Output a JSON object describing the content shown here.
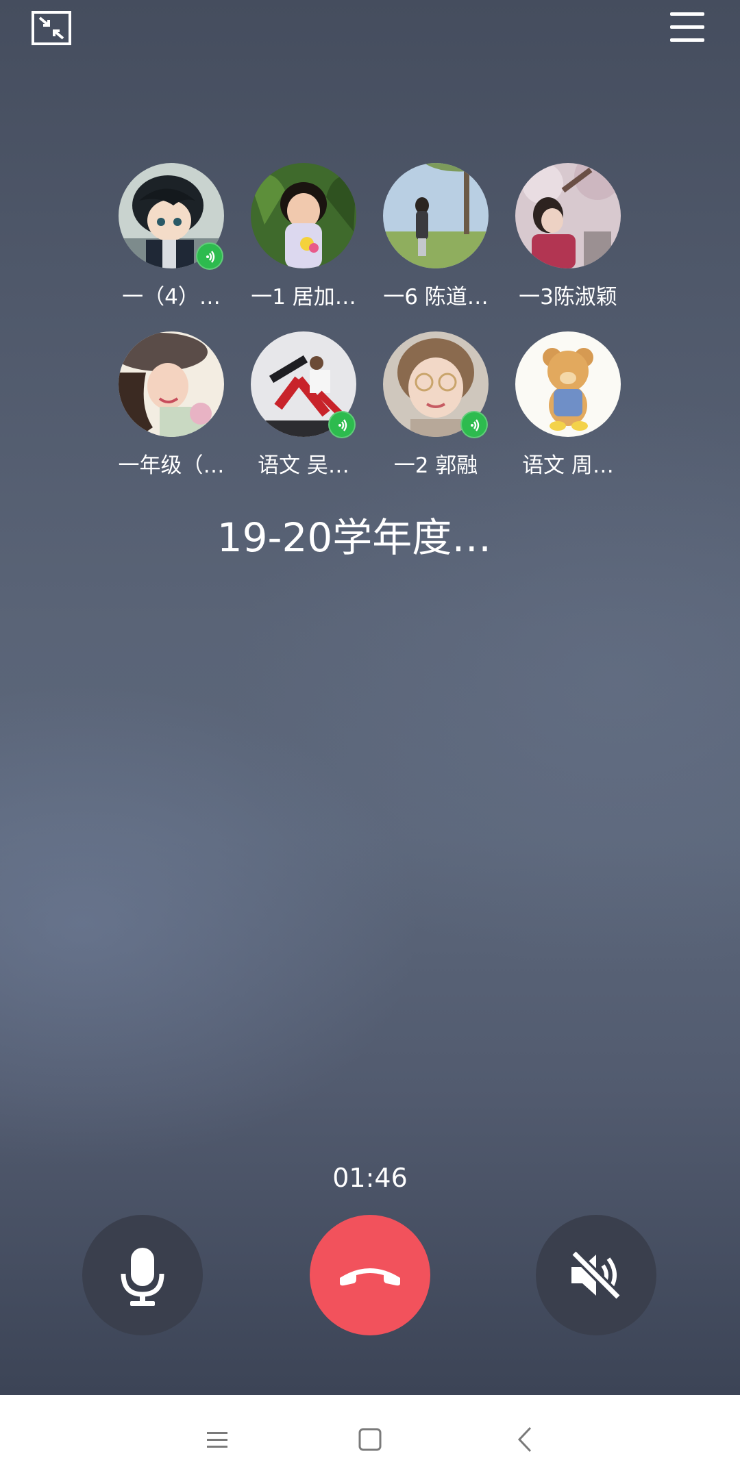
{
  "group_title": "19-20学年度…",
  "call_timer": "01:46",
  "participants": [
    {
      "name": "一（4）…",
      "speaking": true,
      "avatar": "cartoon-boy"
    },
    {
      "name": "一1 居加…",
      "speaking": false,
      "avatar": "girl-with-flowers"
    },
    {
      "name": "一6 陈道…",
      "speaking": false,
      "avatar": "person-under-tree"
    },
    {
      "name": "一3陈淑颖",
      "speaking": false,
      "avatar": "woman-with-blossoms"
    },
    {
      "name": "一年级（…",
      "speaking": false,
      "avatar": "woman-with-hat"
    },
    {
      "name": "语文  吴…",
      "speaking": true,
      "avatar": "dancers"
    },
    {
      "name": "一2 郭融",
      "speaking": true,
      "avatar": "child-with-glasses"
    },
    {
      "name": "语文 周…",
      "speaking": false,
      "avatar": "teddy-bear"
    }
  ],
  "controls": {
    "mic_icon": "microphone-icon",
    "hangup_icon": "hang-up-phone-icon",
    "speaker_icon": "speaker-muted-icon",
    "hangup_color": "#f2525c",
    "speaking_color": "#2dbb4e"
  },
  "system_nav": {
    "menu_icon": "recent-apps-icon",
    "home_icon": "home-square-icon",
    "back_icon": "back-chevron-icon"
  }
}
